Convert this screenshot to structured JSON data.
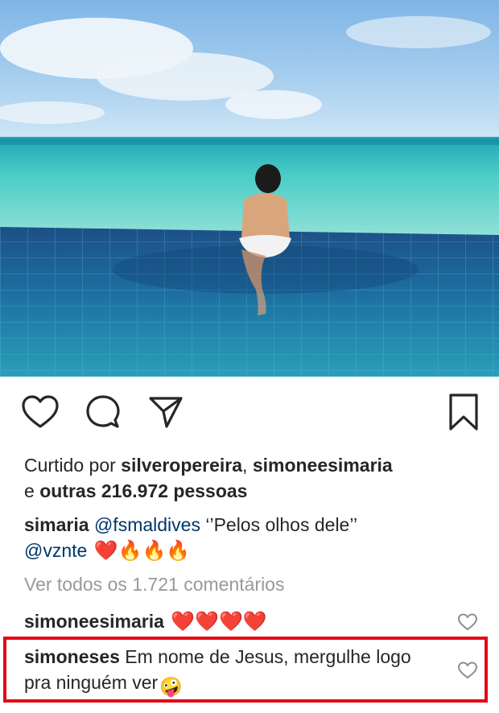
{
  "post": {
    "likes": {
      "prefix": "Curtido por",
      "user1": "silveropereira",
      "separator": ",",
      "user2": "simoneesimaria",
      "conjunction": "e",
      "others": "outras 216.972 pessoas"
    },
    "caption": {
      "username": "simaria",
      "mention1": "@fsmaldives",
      "text": "‘’Pelos olhos dele’’",
      "mention2": "@vznte",
      "emojis": "❤️🔥🔥🔥"
    },
    "view_all_comments": "Ver todos os 1.721 comentários",
    "comments": [
      {
        "username": "simoneesimaria",
        "text": "❤️❤️❤️❤️"
      },
      {
        "username": "simoneses",
        "text": "Em nome de Jesus, mergulhe logo pra ninguém ver",
        "emoji": "🤪"
      }
    ]
  },
  "icons": {
    "like": "heart-outline-icon",
    "comment": "speech-bubble-icon",
    "share": "paper-plane-icon",
    "save": "bookmark-icon",
    "comment_like": "small-heart-icon"
  },
  "colors": {
    "text": "#262626",
    "mention": "#003569",
    "muted": "#999999",
    "highlight_border": "#e40914",
    "heart": "#e0162b"
  }
}
